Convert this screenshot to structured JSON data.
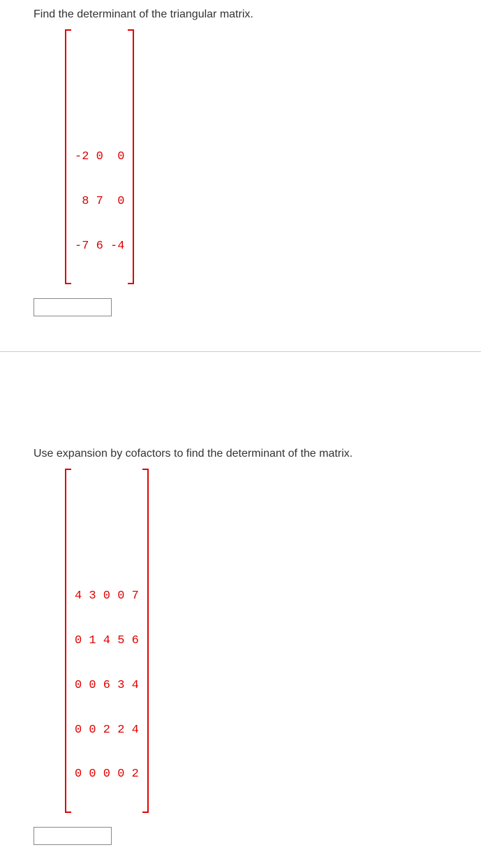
{
  "q1": {
    "prompt": "Find the determinant of the triangular matrix.",
    "matrix_rows": [
      "-2 0  0",
      " 8 7  0",
      "-7 6 -4"
    ],
    "answer_value": "",
    "chart_data": {
      "type": "table",
      "title": "3x3 lower-triangular matrix",
      "rows": 3,
      "cols": 3,
      "values": [
        [
          -2,
          0,
          0
        ],
        [
          8,
          7,
          0
        ],
        [
          -7,
          6,
          -4
        ]
      ]
    }
  },
  "q2": {
    "prompt": "Use expansion by cofactors to find the determinant of the matrix.",
    "matrix_rows": [
      "4 3 0 0 7",
      "0 1 4 5 6",
      "0 0 6 3 4",
      "0 0 2 2 4",
      "0 0 0 0 2"
    ],
    "answer_value": "",
    "chart_data": {
      "type": "table",
      "title": "5x5 matrix",
      "rows": 5,
      "cols": 5,
      "values": [
        [
          4,
          3,
          0,
          0,
          7
        ],
        [
          0,
          1,
          4,
          5,
          6
        ],
        [
          0,
          0,
          6,
          3,
          4
        ],
        [
          0,
          0,
          2,
          2,
          4
        ],
        [
          0,
          0,
          0,
          0,
          2
        ]
      ]
    }
  }
}
